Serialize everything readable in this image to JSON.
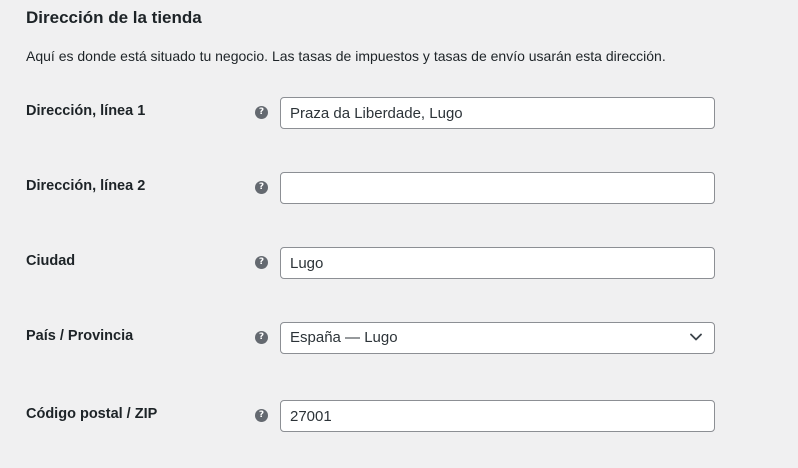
{
  "section": {
    "title": "Dirección de la tienda",
    "description": "Aquí es donde está situado tu negocio. Las tasas de impuestos y tasas de envío usarán esta dirección."
  },
  "fields": {
    "address1": {
      "label": "Dirección, línea 1",
      "value": "Praza da Liberdade, Lugo",
      "help_icon": "question-circle-icon"
    },
    "address2": {
      "label": "Dirección, línea 2",
      "value": "",
      "help_icon": "question-circle-icon"
    },
    "city": {
      "label": "Ciudad",
      "value": "Lugo",
      "help_icon": "question-circle-icon"
    },
    "country": {
      "label": "País / Provincia",
      "selected": "España — Lugo",
      "help_icon": "question-circle-icon",
      "dropdown_icon": "chevron-down-icon"
    },
    "postcode": {
      "label": "Código postal / ZIP",
      "value": "27001",
      "help_icon": "question-circle-icon"
    }
  },
  "help_glyph": "?",
  "colors": {
    "page_background": "#f0f0f1",
    "text": "#1d2327",
    "input_border": "#8c8f94",
    "help_icon": "#646970"
  }
}
